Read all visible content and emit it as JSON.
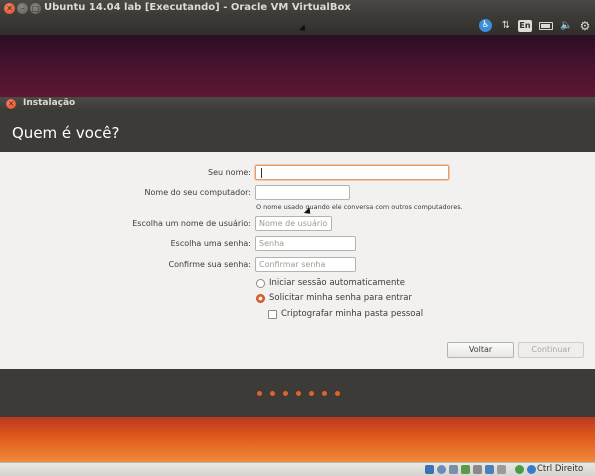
{
  "host_window": {
    "title": "Ubuntu 14.04 lab [Executando] - Oracle VM VirtualBox"
  },
  "guest_panel": {
    "keyboard_layout": "En",
    "icons": [
      "accessibility-icon",
      "network-icon",
      "keyboard-icon",
      "battery-icon",
      "volume-icon",
      "gear-icon"
    ]
  },
  "installer": {
    "window_title": "Instalação",
    "heading": "Quem é você?",
    "fields": {
      "name": {
        "label": "Seu nome:",
        "value": "",
        "placeholder": ""
      },
      "computer_name": {
        "label": "Nome do seu computador:",
        "value": "",
        "placeholder": ""
      },
      "computer_hint": "O nome usado quando ele conversa com outros computadores.",
      "username": {
        "label": "Escolha um nome de usuário:",
        "value": "",
        "placeholder": "Nome de usuário"
      },
      "password": {
        "label": "Escolha uma senha:",
        "value": "",
        "placeholder": "Senha"
      },
      "confirm_password": {
        "label": "Confirme sua senha:",
        "value": "",
        "placeholder": "Confirmar senha"
      }
    },
    "options": {
      "auto_login": {
        "label": "Iniciar sessão automaticamente",
        "selected": false
      },
      "require_password": {
        "label": "Solicitar minha senha para entrar",
        "selected": true
      },
      "encrypt_home": {
        "label": "Criptografar minha pasta pessoal",
        "checked": false
      }
    },
    "buttons": {
      "back": "Voltar",
      "continue": "Continuar"
    },
    "progress": {
      "total_steps": 7
    }
  },
  "vb_status": {
    "host_key": "Ctrl Direito"
  },
  "colors": {
    "accent": "#e0642e",
    "panel": "#3c3b37",
    "body": "#f2f1f0"
  }
}
